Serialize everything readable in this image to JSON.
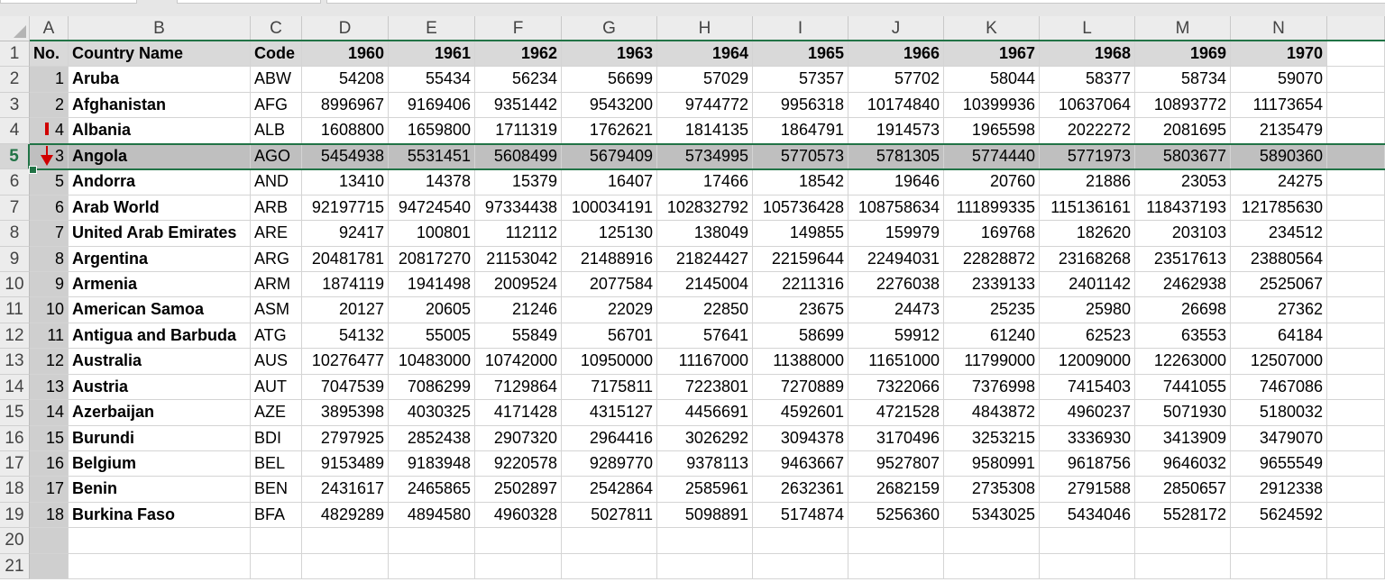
{
  "columns": [
    "A",
    "B",
    "C",
    "D",
    "E",
    "F",
    "G",
    "H",
    "I",
    "J",
    "K",
    "L",
    "M",
    "N"
  ],
  "header": {
    "no": "No.",
    "country": "Country Name",
    "code": "Code",
    "years": [
      "1960",
      "1961",
      "1962",
      "1963",
      "1964",
      "1965",
      "1966",
      "1967",
      "1968",
      "1969",
      "1970"
    ]
  },
  "rows": [
    {
      "no": "1",
      "name": "Aruba",
      "code": "ABW",
      "v": [
        "54208",
        "55434",
        "56234",
        "56699",
        "57029",
        "57357",
        "57702",
        "58044",
        "58377",
        "58734",
        "59070"
      ]
    },
    {
      "no": "2",
      "name": "Afghanistan",
      "code": "AFG",
      "v": [
        "8996967",
        "9169406",
        "9351442",
        "9543200",
        "9744772",
        "9956318",
        "10174840",
        "10399936",
        "10637064",
        "10893772",
        "11173654"
      ]
    },
    {
      "no": "4",
      "name": "Albania",
      "code": "ALB",
      "v": [
        "1608800",
        "1659800",
        "1711319",
        "1762621",
        "1814135",
        "1864791",
        "1914573",
        "1965598",
        "2022272",
        "2081695",
        "2135479"
      ]
    },
    {
      "no": "3",
      "name": "Angola",
      "code": "AGO",
      "v": [
        "5454938",
        "5531451",
        "5608499",
        "5679409",
        "5734995",
        "5770573",
        "5781305",
        "5774440",
        "5771973",
        "5803677",
        "5890360"
      ]
    },
    {
      "no": "5",
      "name": "Andorra",
      "code": "AND",
      "v": [
        "13410",
        "14378",
        "15379",
        "16407",
        "17466",
        "18542",
        "19646",
        "20760",
        "21886",
        "23053",
        "24275"
      ]
    },
    {
      "no": "6",
      "name": "Arab World",
      "code": "ARB",
      "v": [
        "92197715",
        "94724540",
        "97334438",
        "100034191",
        "102832792",
        "105736428",
        "108758634",
        "111899335",
        "115136161",
        "118437193",
        "121785630"
      ]
    },
    {
      "no": "7",
      "name": "United Arab Emirates",
      "code": "ARE",
      "v": [
        "92417",
        "100801",
        "112112",
        "125130",
        "138049",
        "149855",
        "159979",
        "169768",
        "182620",
        "203103",
        "234512"
      ]
    },
    {
      "no": "8",
      "name": "Argentina",
      "code": "ARG",
      "v": [
        "20481781",
        "20817270",
        "21153042",
        "21488916",
        "21824427",
        "22159644",
        "22494031",
        "22828872",
        "23168268",
        "23517613",
        "23880564"
      ]
    },
    {
      "no": "9",
      "name": "Armenia",
      "code": "ARM",
      "v": [
        "1874119",
        "1941498",
        "2009524",
        "2077584",
        "2145004",
        "2211316",
        "2276038",
        "2339133",
        "2401142",
        "2462938",
        "2525067"
      ]
    },
    {
      "no": "10",
      "name": "American Samoa",
      "code": "ASM",
      "v": [
        "20127",
        "20605",
        "21246",
        "22029",
        "22850",
        "23675",
        "24473",
        "25235",
        "25980",
        "26698",
        "27362"
      ]
    },
    {
      "no": "11",
      "name": "Antigua and Barbuda",
      "code": "ATG",
      "v": [
        "54132",
        "55005",
        "55849",
        "56701",
        "57641",
        "58699",
        "59912",
        "61240",
        "62523",
        "63553",
        "64184"
      ]
    },
    {
      "no": "12",
      "name": "Australia",
      "code": "AUS",
      "v": [
        "10276477",
        "10483000",
        "10742000",
        "10950000",
        "11167000",
        "11388000",
        "11651000",
        "11799000",
        "12009000",
        "12263000",
        "12507000"
      ]
    },
    {
      "no": "13",
      "name": "Austria",
      "code": "AUT",
      "v": [
        "7047539",
        "7086299",
        "7129864",
        "7175811",
        "7223801",
        "7270889",
        "7322066",
        "7376998",
        "7415403",
        "7441055",
        "7467086"
      ]
    },
    {
      "no": "14",
      "name": "Azerbaijan",
      "code": "AZE",
      "v": [
        "3895398",
        "4030325",
        "4171428",
        "4315127",
        "4456691",
        "4592601",
        "4721528",
        "4843872",
        "4960237",
        "5071930",
        "5180032"
      ]
    },
    {
      "no": "15",
      "name": "Burundi",
      "code": "BDI",
      "v": [
        "2797925",
        "2852438",
        "2907320",
        "2964416",
        "3026292",
        "3094378",
        "3170496",
        "3253215",
        "3336930",
        "3413909",
        "3479070"
      ]
    },
    {
      "no": "16",
      "name": "Belgium",
      "code": "BEL",
      "v": [
        "9153489",
        "9183948",
        "9220578",
        "9289770",
        "9378113",
        "9463667",
        "9527807",
        "9580991",
        "9618756",
        "9646032",
        "9655549"
      ]
    },
    {
      "no": "17",
      "name": "Benin",
      "code": "BEN",
      "v": [
        "2431617",
        "2465865",
        "2502897",
        "2542864",
        "2585961",
        "2632361",
        "2682159",
        "2735308",
        "2791588",
        "2850657",
        "2912338"
      ]
    },
    {
      "no": "18",
      "name": "Burkina Faso",
      "code": "BFA",
      "v": [
        "4829289",
        "4894580",
        "4960328",
        "5027811",
        "5098891",
        "5174874",
        "5256360",
        "5343025",
        "5434046",
        "5528172",
        "5624592"
      ]
    }
  ],
  "row_numbers": [
    "1",
    "2",
    "3",
    "4",
    "5",
    "6",
    "7",
    "8",
    "9",
    "10",
    "11",
    "12",
    "13",
    "14",
    "15",
    "16",
    "17",
    "18",
    "19",
    "20",
    "21"
  ],
  "selected_row": "5",
  "accent_color": "#217346",
  "arrow_color": "#d00000"
}
